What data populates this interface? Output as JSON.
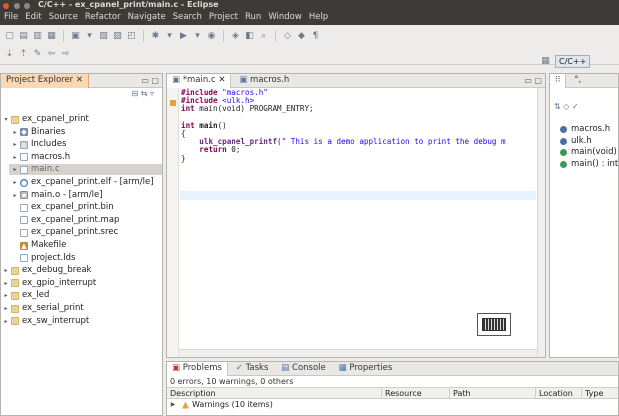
{
  "window": {
    "title": "C/C++ - ex_cpanel_print/main.c - Eclipse",
    "close_color": "#e2572f",
    "dot_color": "#8b8a85"
  },
  "menu": [
    "File",
    "Edit",
    "Source",
    "Refactor",
    "Navigate",
    "Search",
    "Project",
    "Run",
    "Window",
    "Help"
  ],
  "perspective": {
    "label": "C/C++"
  },
  "explorer": {
    "tab_label": "Project Explorer",
    "tab_close": "✕",
    "tab_controls": "▭ ▢",
    "toolbar_icons": [
      "collapse-all-icon",
      "link-editor-icon",
      "view-menu-icon"
    ],
    "tree": [
      {
        "label": "ex_cpanel_print",
        "icon": "project-folder-icon",
        "kind": "proj",
        "depth": 0,
        "expanded": true
      },
      {
        "label": "Binaries",
        "icon": "binaries-icon",
        "kind": "bin",
        "depth": 1,
        "expanded": false
      },
      {
        "label": "Includes",
        "icon": "includes-icon",
        "kind": "inc",
        "depth": 1,
        "expanded": false
      },
      {
        "label": "macros.h",
        "icon": "header-file-icon",
        "kind": "file",
        "depth": 1,
        "expanded": false
      },
      {
        "label": "main.c",
        "icon": "c-file-icon",
        "kind": "file",
        "depth": 1,
        "expanded": false,
        "selected": true
      },
      {
        "label": "ex_cpanel_print.elf - [arm/le]",
        "icon": "elf-binary-icon",
        "kind": "elf",
        "depth": 1,
        "expanded": false
      },
      {
        "label": "main.o - [arm/le]",
        "icon": "object-file-icon",
        "kind": "obj",
        "depth": 1,
        "expanded": false
      },
      {
        "label": "ex_cpanel_print.bin",
        "icon": "file-icon",
        "kind": "file",
        "depth": 1,
        "leaf": true
      },
      {
        "label": "ex_cpanel_print.map",
        "icon": "file-icon",
        "kind": "file",
        "depth": 1,
        "leaf": true
      },
      {
        "label": "ex_cpanel_print.srec",
        "icon": "file-icon",
        "kind": "file",
        "depth": 1,
        "leaf": true
      },
      {
        "label": "Makefile",
        "icon": "makefile-icon",
        "kind": "make",
        "depth": 1,
        "leaf": true
      },
      {
        "label": "project.lds",
        "icon": "file-icon",
        "kind": "file",
        "depth": 1,
        "leaf": true
      },
      {
        "label": "ex_debug_break",
        "icon": "project-folder-icon",
        "kind": "proj",
        "depth": 0,
        "expanded": false
      },
      {
        "label": "ex_gpio_interrupt",
        "icon": "project-folder-icon",
        "kind": "proj",
        "depth": 0,
        "expanded": false
      },
      {
        "label": "ex_led",
        "icon": "project-folder-icon",
        "kind": "proj",
        "depth": 0,
        "expanded": false
      },
      {
        "label": "ex_serial_print",
        "icon": "project-folder-icon",
        "kind": "proj",
        "depth": 0,
        "expanded": false
      },
      {
        "label": "ex_sw_interrupt",
        "icon": "project-folder-icon",
        "kind": "proj",
        "depth": 0,
        "expanded": false
      }
    ]
  },
  "editor": {
    "tabs": [
      {
        "label": "*main.c",
        "close": "✕",
        "active": true
      },
      {
        "label": "macros.h",
        "active": false
      }
    ],
    "tab_controls": "▭ ▢",
    "code": {
      "line1_kw": "#include",
      "line1_str": " \"macros.h\"",
      "line2_kw": "#include",
      "line2_str": " <ulk.h>",
      "line3_kw": "int",
      "line3_rest": " main(void) PROGRAM_ENTRY;",
      "line5_kw": "int",
      "line5_fn": " main",
      "line5_rest": "()",
      "line6": "{",
      "line7_fn": "ulk_cpanel_printf",
      "line7_rest": "(",
      "line7_str": "\" This is a demo application to print the debug m",
      "line8_kw": "return",
      "line8_rest": " 0;",
      "line9": "}"
    }
  },
  "outline": {
    "tab_labels": [
      "⁝⁝",
      "°,"
    ],
    "items": [
      {
        "label": "macros.h",
        "color": "#4a6fa5"
      },
      {
        "label": "ulk.h",
        "color": "#4a6fa5"
      },
      {
        "label": "main(void)",
        "color": "#3a9a58"
      },
      {
        "label": "main() : int",
        "color": "#3a9a58"
      }
    ]
  },
  "problems": {
    "tabs": [
      "Problems",
      "Tasks",
      "Console",
      "Properties"
    ],
    "summary": "0 errors, 10 warnings, 0 others",
    "columns": [
      "Description",
      "Resource",
      "Path",
      "Location",
      "Type"
    ],
    "rows": [
      {
        "label": "Warnings (10 items)"
      }
    ]
  }
}
